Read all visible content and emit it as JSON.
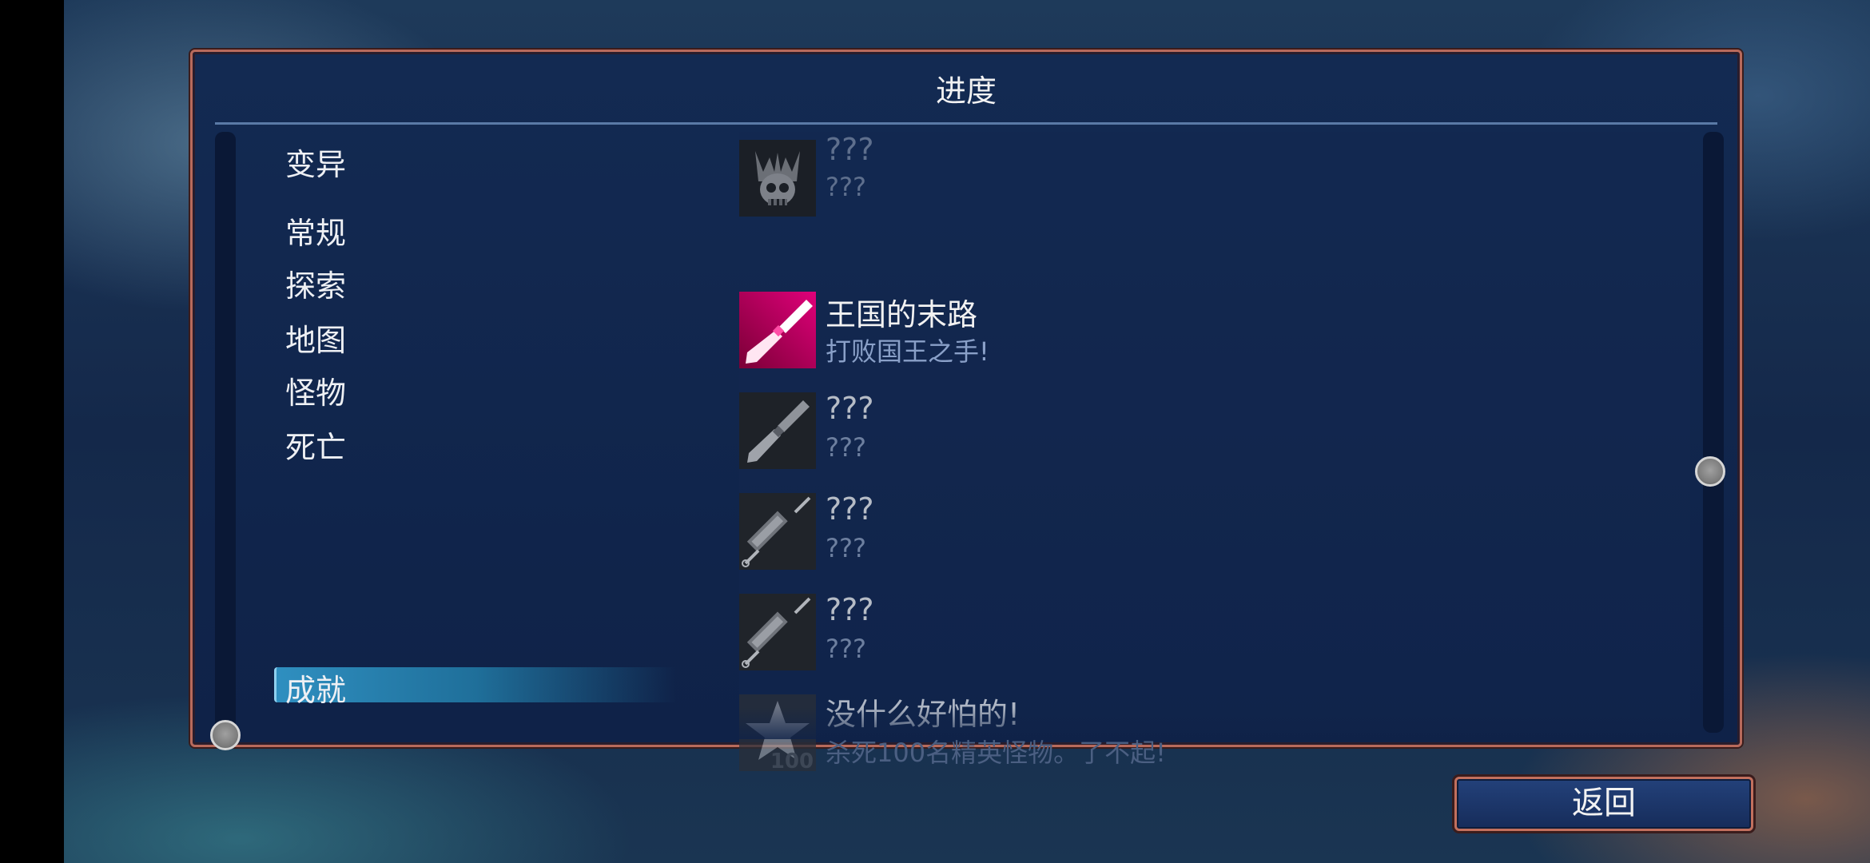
{
  "panel": {
    "title": "进度"
  },
  "categories": [
    {
      "label": "变异"
    },
    {
      "label": "常规"
    },
    {
      "label": "探索"
    },
    {
      "label": "地图"
    },
    {
      "label": "怪物"
    },
    {
      "label": "死亡"
    },
    {
      "label": "成就",
      "selected": true
    }
  ],
  "achievements": [
    {
      "title": "???",
      "description": "???",
      "icon": "horned-skull-icon",
      "state": "locked"
    },
    {
      "title": "王国的末路",
      "description": "打败国王之手!",
      "icon": "crimson-blade-icon",
      "state": "unlocked"
    },
    {
      "title": "???",
      "description": "???",
      "icon": "grey-blade-icon",
      "state": "locked"
    },
    {
      "title": "???",
      "description": "???",
      "icon": "syringe-icon",
      "state": "locked"
    },
    {
      "title": "???",
      "description": "???",
      "icon": "syringe-icon",
      "state": "locked"
    },
    {
      "title": "没什么好怕的!",
      "description": "杀死100名精英怪物。了不起!",
      "icon": "star-icon",
      "icon_label": "100",
      "state": "locked"
    }
  ],
  "footer": {
    "back_label": "返回"
  },
  "colors": {
    "accent_border": "#b86a5c",
    "panel_bg": "#132a52",
    "selected_tab": "#2f8fc0",
    "unlocked_icon": "#d4006a"
  }
}
